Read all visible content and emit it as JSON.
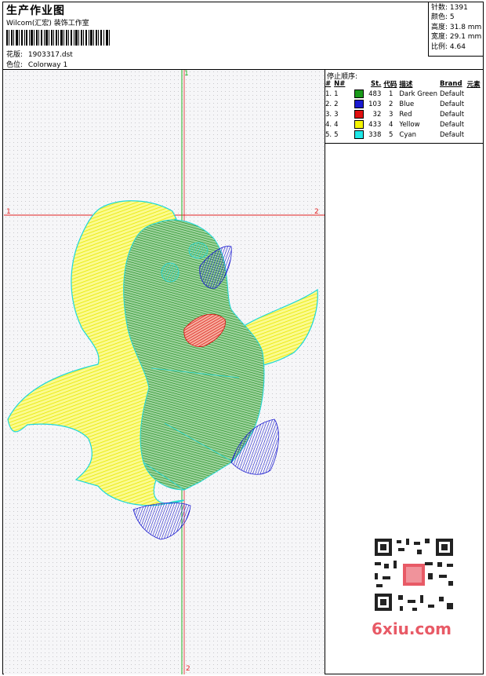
{
  "header": {
    "title": "生产作业图",
    "subtitle": "Wilcom(汇宏) 装饰工作室",
    "design_label": "花版:",
    "design_value": "1903317.dst",
    "colorway_label": "色位:",
    "colorway_value": "Colorway 1"
  },
  "stats": {
    "stitches": "针数: 1391",
    "colors": "颜色: 5",
    "height": "高度: 31.8 mm",
    "width": "宽度: 29.1 mm",
    "scale": "比例: 4.64"
  },
  "stop_sequence": {
    "title": "停止顺序:",
    "headers": [
      "#",
      "N#",
      "St.",
      "代码",
      "描述",
      "Brand",
      "元素"
    ],
    "rows": [
      {
        "idx": "1.",
        "n": "1",
        "color": "#1a9a1a",
        "st": "483",
        "code": "1",
        "desc": "Dark Green",
        "brand": "Default"
      },
      {
        "idx": "2.",
        "n": "2",
        "color": "#1a1ad0",
        "st": "103",
        "code": "2",
        "desc": "Blue",
        "brand": "Default"
      },
      {
        "idx": "3.",
        "n": "3",
        "color": "#e01010",
        "st": "32",
        "code": "3",
        "desc": "Red",
        "brand": "Default"
      },
      {
        "idx": "4.",
        "n": "4",
        "color": "#f5f500",
        "st": "433",
        "code": "4",
        "desc": "Yellow",
        "brand": "Default"
      },
      {
        "idx": "5.",
        "n": "5",
        "color": "#20e8e8",
        "st": "338",
        "code": "5",
        "desc": "Cyan",
        "brand": "Default"
      }
    ]
  },
  "canvas_marks": {
    "h_left": "1",
    "h_right": "2",
    "v_top": "1",
    "v_bottom": "2"
  },
  "watermark": {
    "text": "6xiu.com"
  },
  "colors": {
    "guide_red": "#e02020",
    "guide_green": "#20b020"
  }
}
